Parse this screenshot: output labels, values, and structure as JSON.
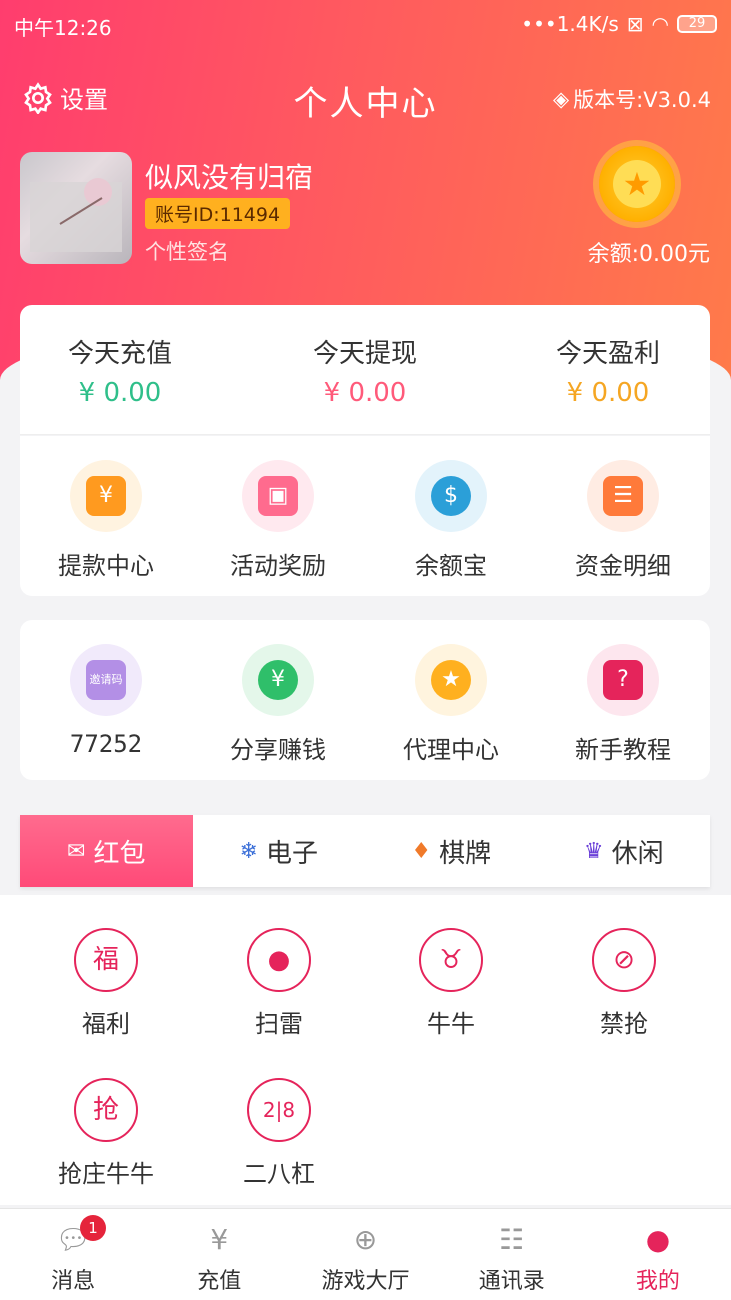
{
  "status_bar": {
    "time": "中午12:26",
    "speed": "•••1.4K/s",
    "battery": "29"
  },
  "header": {
    "settings_label": "设置",
    "title": "个人中心",
    "version": "版本号:V3.0.4"
  },
  "profile": {
    "username": "似风没有归宿",
    "account_id": "账号ID:11494",
    "signature": "个性签名",
    "balance": "余额:0.00元"
  },
  "stats": [
    {
      "label": "今天充值",
      "value": "¥ 0.00",
      "color": "#2fbf8a"
    },
    {
      "label": "今天提现",
      "value": "¥ 0.00",
      "color": "#ff5a7a"
    },
    {
      "label": "今天盈利",
      "value": "¥ 0.00",
      "color": "#f5a623"
    }
  ],
  "grid1": [
    {
      "label": "提款中心",
      "icon": "withdraw-icon",
      "color": "#ff9a1f"
    },
    {
      "label": "活动奖励",
      "icon": "gift-icon",
      "color": "#ff6b8e"
    },
    {
      "label": "余额宝",
      "icon": "money-bag-icon",
      "color": "#2b9fd8"
    },
    {
      "label": "资金明细",
      "icon": "clipboard-icon",
      "color": "#ff7a3a"
    }
  ],
  "grid2": [
    {
      "label": "77252",
      "icon": "invite-code-icon",
      "icon_text": "邀请码",
      "color": "#b38fe6"
    },
    {
      "label": "分享赚钱",
      "icon": "share-money-icon",
      "color": "#2fbf6a"
    },
    {
      "label": "代理中心",
      "icon": "agent-medal-icon",
      "color": "#ffb01f"
    },
    {
      "label": "新手教程",
      "icon": "tutorial-book-icon",
      "color": "#e5245b"
    }
  ],
  "tabs": [
    {
      "label": "红包",
      "icon": "red-envelope-icon",
      "active": true
    },
    {
      "label": "电子",
      "icon": "electronic-icon",
      "active": false
    },
    {
      "label": "棋牌",
      "icon": "cards-icon",
      "active": false
    },
    {
      "label": "休闲",
      "icon": "leisure-icon",
      "active": false
    }
  ],
  "games": [
    {
      "label": "福利",
      "icon": "welfare-envelope-icon"
    },
    {
      "label": "扫雷",
      "icon": "bomb-icon"
    },
    {
      "label": "牛牛",
      "icon": "bull-icon"
    },
    {
      "label": "禁抢",
      "icon": "no-grab-icon"
    },
    {
      "label": "抢庄牛牛",
      "icon": "grab-bull-icon"
    },
    {
      "label": "二八杠",
      "icon": "dice-28-icon"
    }
  ],
  "nav": [
    {
      "label": "消息",
      "icon": "message-icon",
      "badge": "1"
    },
    {
      "label": "充值",
      "icon": "recharge-icon"
    },
    {
      "label": "游戏大厅",
      "icon": "gamepad-icon"
    },
    {
      "label": "通讯录",
      "icon": "contacts-icon"
    },
    {
      "label": "我的",
      "icon": "profile-icon",
      "active": true
    }
  ]
}
